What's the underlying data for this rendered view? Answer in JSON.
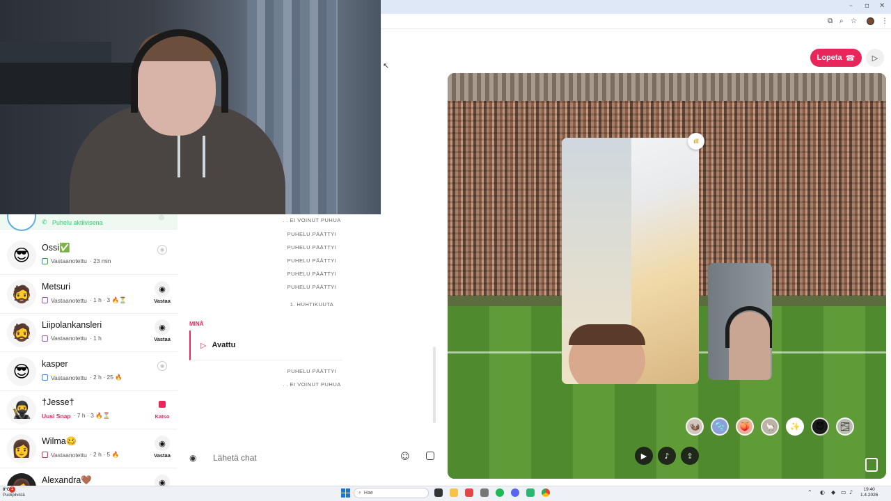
{
  "call": {
    "end_label": "Lopeta",
    "end_icon": "phone-hangup-icon",
    "play_icon": "play-icon"
  },
  "chat_list": {
    "active_status": "Puhelu aktiivisena",
    "items": [
      {
        "name": "Ossi✅",
        "status": "Vastaanotettu",
        "meta": "· 23 min",
        "status_color": "blue",
        "action": "",
        "avatar": "😎"
      },
      {
        "name": "Metsuri",
        "status": "Vastaanotettu",
        "meta": "· 1 h · 3 🔥⏳",
        "status_color": "purple",
        "action": "Vastaa",
        "avatar": "🧔"
      },
      {
        "name": "Liipolankansleri",
        "status": "Vastaanotettu",
        "meta": "· 1 h",
        "status_color": "purple",
        "action": "Vastaa",
        "avatar": "🧔"
      },
      {
        "name": "kasper",
        "status": "Vastaanotettu",
        "meta": "· 2 h · 25 🔥",
        "status_color": "blue",
        "action": "",
        "avatar": "😎"
      },
      {
        "name": "†Jesse†",
        "status": "Uusi Snap",
        "meta": "· 7 h · 3 🔥⏳",
        "status_color": "red",
        "action": "Katso",
        "avatar": "🥷"
      },
      {
        "name": "Wilma🥴",
        "status": "Vastaanotettu",
        "meta": "· 2 h · 5 🔥",
        "status_color": "red",
        "action": "Vastaa",
        "avatar": "👩"
      },
      {
        "name": "Alexandra🤎",
        "status": "",
        "meta": "",
        "status_color": "purple",
        "action": "",
        "avatar": "👩"
      }
    ]
  },
  "conversation": {
    "messages_top": [
      ". . EI VOINUT PUHUA",
      "PUHELU PÄÄTTYI",
      "PUHELU PÄÄTTYI",
      "PUHELU PÄÄTTYI",
      "PUHELU PÄÄTTYI",
      "PUHELU PÄÄTTYI"
    ],
    "date_separator": "1. HUHTIKUUTA",
    "me_label": "MINÄ",
    "opened_label": "Avattu",
    "messages_bottom": [
      "PUHELU PÄÄTTYI",
      ". . EI VOINUT PUHUA"
    ],
    "input_placeholder": "Lähetä chat"
  },
  "stage": {
    "lenses": [
      "🦦",
      "🫧",
      "🍑",
      "🦙",
      "✨",
      "😈",
      "🌫"
    ],
    "controls": [
      "video-icon",
      "mic-icon",
      "share-icon"
    ]
  },
  "taskbar": {
    "weather_temp": "8°C",
    "weather_desc": "Puolipilvistä",
    "search_placeholder": "Hae",
    "time": "19:40",
    "date": "1.4.2026",
    "notification_count": "1"
  },
  "colors": {
    "accent": "#e8265c",
    "active_green": "#2ecc71"
  }
}
